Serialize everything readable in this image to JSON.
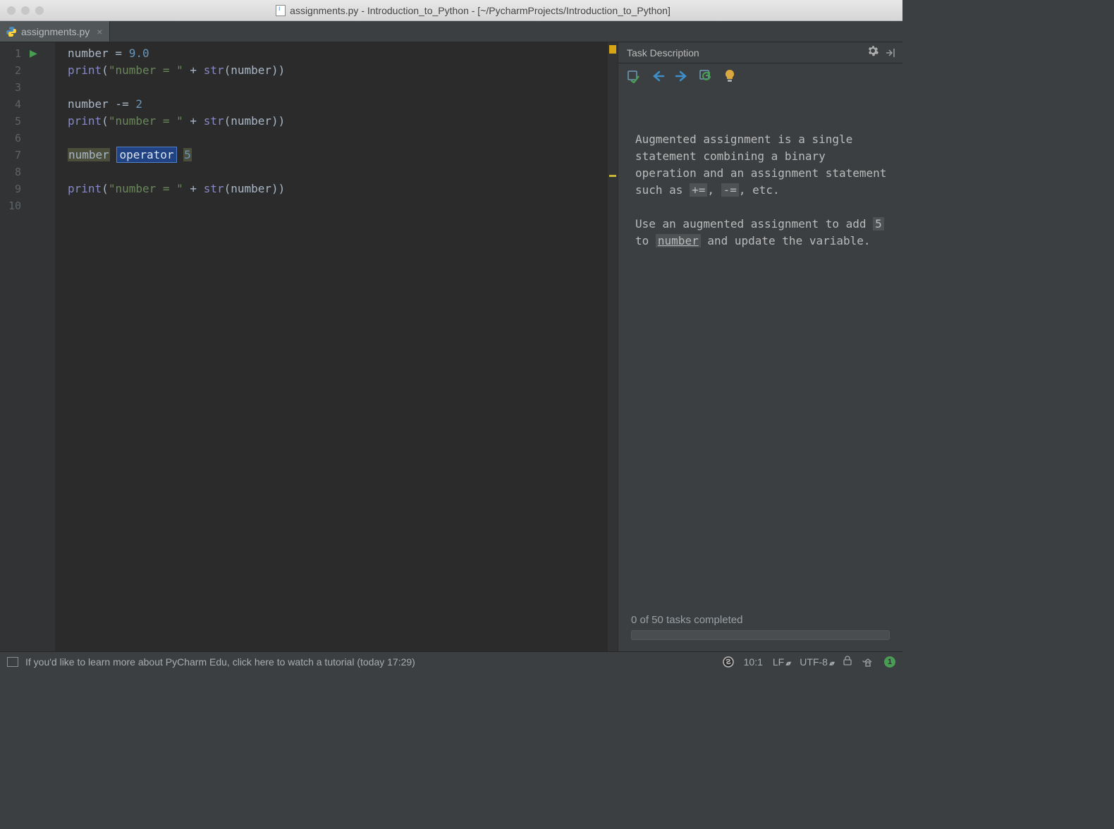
{
  "window": {
    "title": "assignments.py - Introduction_to_Python - [~/PycharmProjects/Introduction_to_Python]"
  },
  "tab": {
    "filename": "assignments.py"
  },
  "editor": {
    "line_count": 10,
    "lines": {
      "l1_var": "number",
      "l1_eq": " = ",
      "l1_val": "9.0",
      "l2_fn": "print",
      "l2_str": "\"number = \"",
      "l2_plus": " + ",
      "l2_str2": "str",
      "l2_var": "number",
      "l4_var": "number",
      "l4_op": " -= ",
      "l4_val": "2",
      "l5_fn": "print",
      "l5_str": "\"number = \"",
      "l5_plus": " + ",
      "l5_str2": "str",
      "l5_var": "number",
      "l7_ph_var": "number",
      "l7_ph_op": "operator",
      "l7_ph_val": "5",
      "l9_fn": "print",
      "l9_str": "\"number = \"",
      "l9_plus": " + ",
      "l9_str2": "str",
      "l9_var": "number"
    }
  },
  "task": {
    "header": "Task Description",
    "p1_a": "Augmented assignment is a single statement combining a binary operation and an assignment statement such as ",
    "p1_op1": "+=",
    "p1_sep": ", ",
    "p1_op2": "-=",
    "p1_b": ", etc.",
    "p2_a": "Use an augmented assignment to add ",
    "p2_val": "5",
    "p2_b": " to ",
    "p2_var": "number",
    "p2_c": " and update the variable."
  },
  "progress": {
    "text": "0 of 50 tasks completed"
  },
  "statusbar": {
    "hint": "If you'd like to learn more about PyCharm Edu, click here to watch a tutorial (today 17:29)",
    "pos": "10:1",
    "line_sep": "LF",
    "encoding": "UTF-8",
    "info": "1"
  }
}
